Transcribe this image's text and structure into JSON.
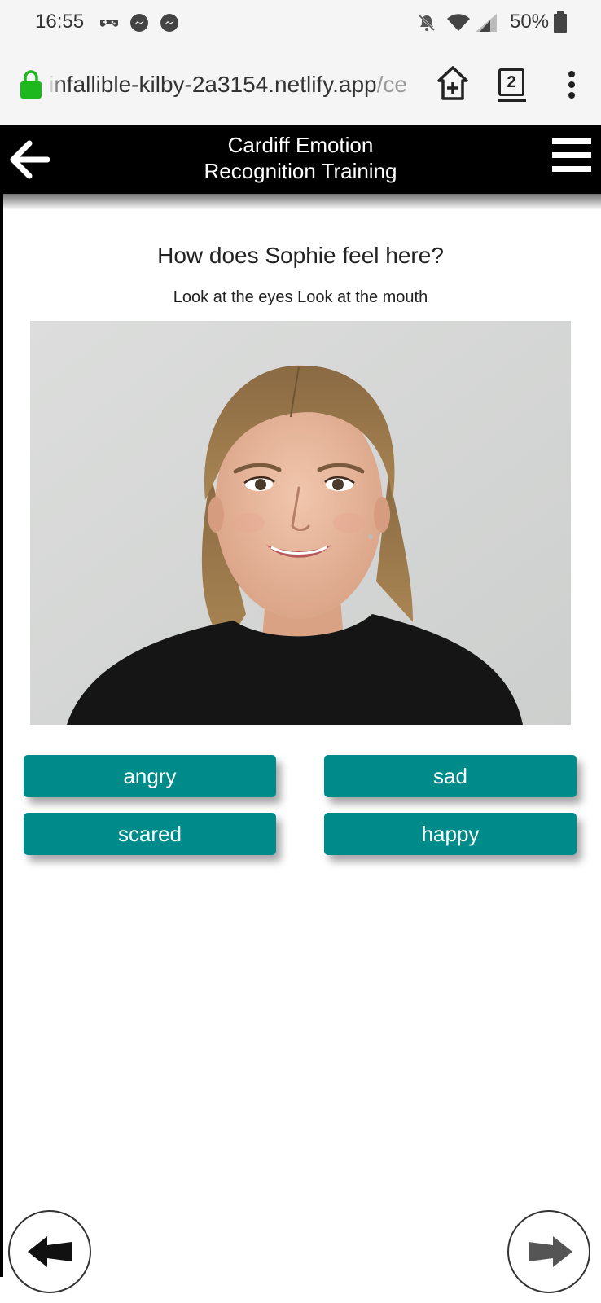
{
  "status_bar": {
    "time": "16:55",
    "battery": "50%",
    "icons": [
      "gamepad-icon",
      "messenger-icon",
      "messenger-icon",
      "bell-off-icon",
      "wifi-icon",
      "signal-icon",
      "battery-icon"
    ]
  },
  "browser": {
    "url_domain": "infallible-kilby-2a3154.netlify.app",
    "url_path": "/ce",
    "tab_count": "2",
    "icons": [
      "lock-icon",
      "add-to-home-icon",
      "more-vert-icon"
    ]
  },
  "header": {
    "title_line1": "Cardiff Emotion",
    "title_line2": "Recognition Training",
    "icons": [
      "back-arrow-icon",
      "hamburger-menu-icon"
    ]
  },
  "question": {
    "text": "How does Sophie feel here?",
    "hint": "Look at the eyes Look at the mouth"
  },
  "answers": {
    "angry": "angry",
    "sad": "sad",
    "scared": "scared",
    "happy": "happy"
  },
  "nav": {
    "icons": [
      "previous-arrow-icon",
      "next-arrow-icon"
    ]
  },
  "colors": {
    "accent": "#008b8b",
    "header_bg": "#000000",
    "browser_bg": "#f5f5f5",
    "lock_green": "#1db81d",
    "next_arrow": "#555555"
  }
}
